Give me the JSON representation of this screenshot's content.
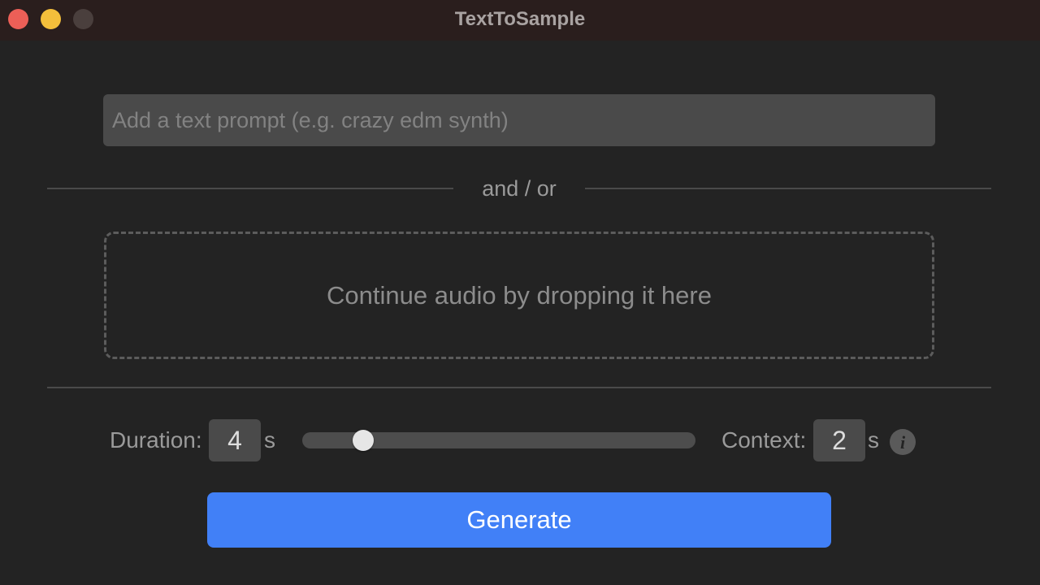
{
  "window": {
    "title": "TextToSample"
  },
  "prompt": {
    "value": "",
    "placeholder": "Add a text prompt (e.g. crazy edm synth)"
  },
  "separator": {
    "label": "and / or"
  },
  "dropzone": {
    "label": "Continue audio by dropping it here"
  },
  "duration": {
    "label": "Duration:",
    "value": "4",
    "unit": "s",
    "slider_fraction": 0.155
  },
  "context": {
    "label": "Context:",
    "value": "2",
    "unit": "s",
    "info_icon": "info-icon"
  },
  "generate": {
    "label": "Generate"
  },
  "colors": {
    "accent": "#4180f7",
    "background": "#232323",
    "titlebar": "#2a1e1d",
    "close": "#ec5f57",
    "minimize": "#f4bf3b",
    "maximize_inactive": "#4a3f3d"
  }
}
